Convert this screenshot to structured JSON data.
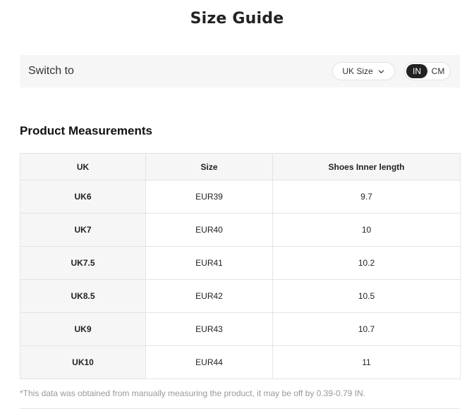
{
  "title": "Size Guide",
  "switch": {
    "label": "Switch to",
    "size_system": "UK Size",
    "units": [
      "IN",
      "CM"
    ],
    "active_unit": "IN"
  },
  "section_title": "Product Measurements",
  "table": {
    "headers": [
      "UK",
      "Size",
      "Shoes Inner length"
    ],
    "rows": [
      [
        "UK6",
        "EUR39",
        "9.7"
      ],
      [
        "UK7",
        "EUR40",
        "10"
      ],
      [
        "UK7.5",
        "EUR41",
        "10.2"
      ],
      [
        "UK8.5",
        "EUR42",
        "10.5"
      ],
      [
        "UK9",
        "EUR43",
        "10.7"
      ],
      [
        "UK10",
        "EUR44",
        "11"
      ]
    ]
  },
  "note": "*This data was obtained from manually measuring the product, it may be off by 0.39-0.79 IN.",
  "colors": {
    "accent": "#222222",
    "panel_bg": "#f6f6f6",
    "border": "#e4e4e4",
    "note_text": "#999999"
  },
  "icons": {
    "size_select": "chevron-down-icon"
  }
}
